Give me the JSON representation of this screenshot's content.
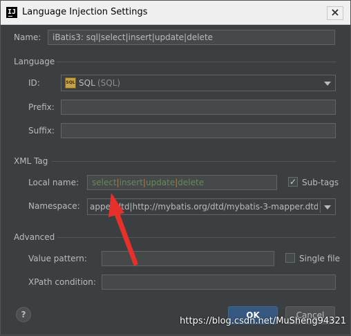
{
  "window": {
    "title": "Language Injection Settings",
    "close_glyph": "×"
  },
  "name": {
    "label": "Name:",
    "value": "iBatis3: sql|select|insert|update|delete"
  },
  "language": {
    "section": "Language",
    "id_label": "ID:",
    "id_value": "SQL",
    "id_secondary": "(SQL)",
    "sql_icon_text": "SQL",
    "prefix_label": "Prefix:",
    "prefix_value": "",
    "suffix_label": "Suffix:",
    "suffix_value": ""
  },
  "xml_tag": {
    "section": "XML Tag",
    "local_name_label": "Local name:",
    "local_name_tokens": [
      {
        "text": "select"
      },
      {
        "text": "|"
      },
      {
        "text": "insert"
      },
      {
        "text": "|"
      },
      {
        "text": "update"
      },
      {
        "text": "|"
      },
      {
        "text": "delete"
      }
    ],
    "subtags_label": "Sub-tags",
    "subtags_checked": true,
    "namespace_label": "Namespace:",
    "namespace_value": "apper.dtd|http://mybatis.org/dtd/mybatis-3-mapper.dtd"
  },
  "advanced": {
    "section": "Advanced",
    "value_pattern_label": "Value pattern:",
    "value_pattern_value": "",
    "single_file_label": "Single file",
    "single_file_checked": false,
    "xpath_label": "XPath condition:",
    "xpath_value": ""
  },
  "footer": {
    "help_label": "?",
    "ok_label": "OK",
    "cancel_label": "Cancel"
  },
  "watermark": "https://blog.csdn.net/MuSheng94321",
  "colors": {
    "accent": "#365880",
    "annotation_arrow": "#e8302a",
    "sql_green": "#6a8759",
    "separator_orange": "#cc7832"
  },
  "icons": {
    "app": "intellij-icon",
    "sql": "sql-icon",
    "dropdown": "chevron-down-icon",
    "annotation": "red-arrow"
  }
}
